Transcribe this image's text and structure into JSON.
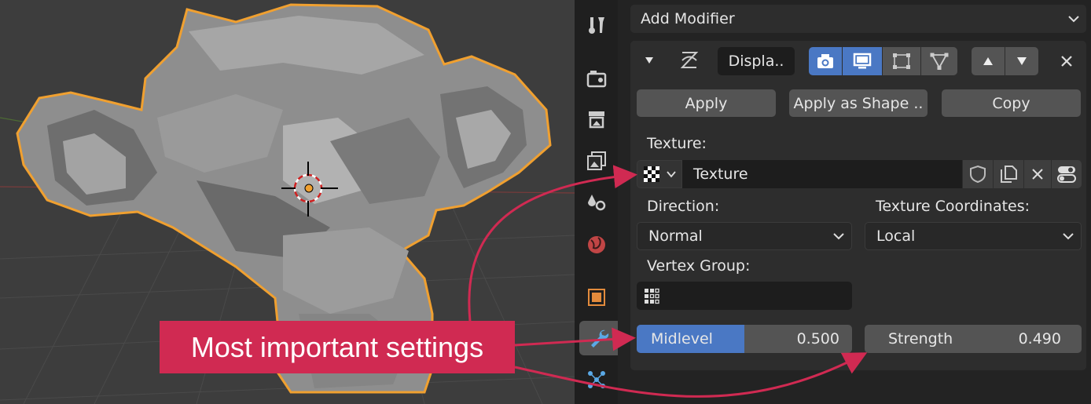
{
  "colors": {
    "accent_blue": "#4a78c4",
    "outline_orange": "#f0a030",
    "annotation_red": "#d02a52"
  },
  "tabs": [
    {
      "name": "tool-icon"
    },
    {
      "name": "render-icon"
    },
    {
      "name": "output-icon"
    },
    {
      "name": "view-layer-icon"
    },
    {
      "name": "scene-icon"
    },
    {
      "name": "world-icon"
    },
    {
      "name": "object-icon"
    },
    {
      "name": "modifier-wrench-icon",
      "active": true
    },
    {
      "name": "particles-icon"
    }
  ],
  "panel": {
    "add_modifier": "Add Modifier",
    "modifier_name": "Displa..",
    "apply": "Apply",
    "apply_as_shape": "Apply as Shape ..",
    "copy": "Copy",
    "texture_label": "Texture:",
    "texture_value": "Texture",
    "direction_label": "Direction:",
    "direction_value": "Normal",
    "texcoord_label": "Texture Coordinates:",
    "texcoord_value": "Local",
    "vertex_group_label": "Vertex Group:",
    "midlevel_label": "Midlevel",
    "midlevel_value": "0.500",
    "midlevel_fraction": 0.5,
    "strength_label": "Strength",
    "strength_value": "0.490"
  },
  "annotation": {
    "text": "Most important settings"
  }
}
